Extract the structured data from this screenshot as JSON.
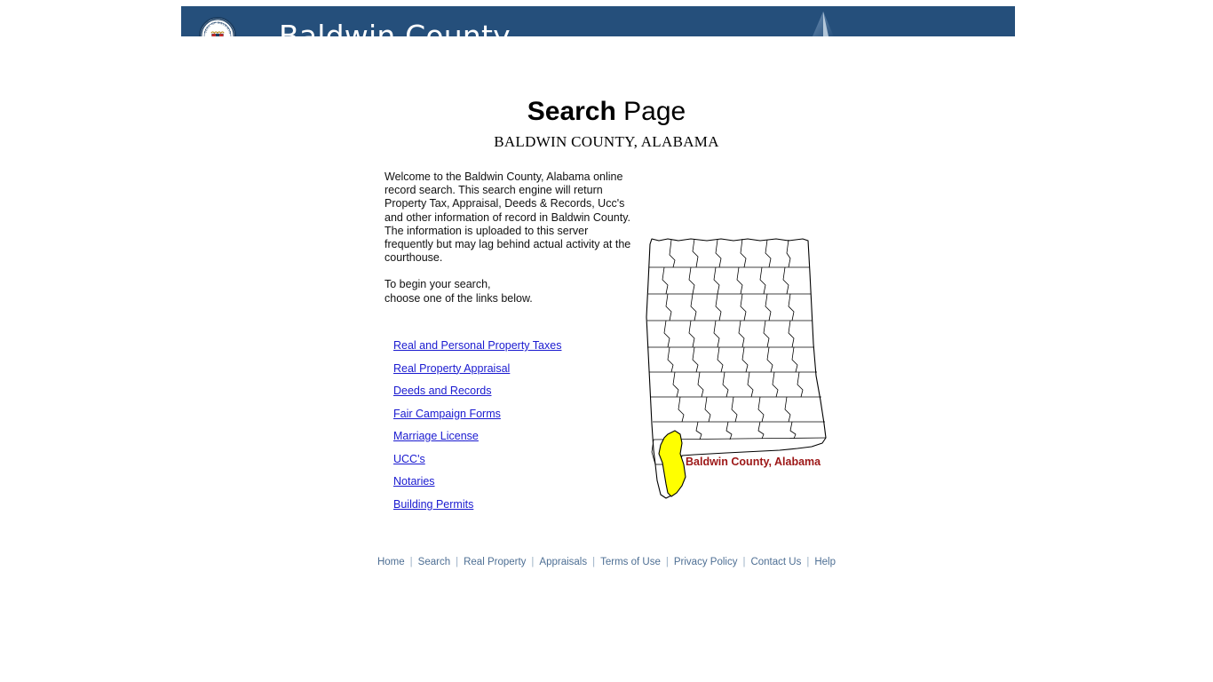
{
  "header": {
    "title": "Baldwin County",
    "seal_text": "SEAL OF BALDWIN COUNTY AL",
    "background_color": "#254f7b"
  },
  "title_block": {
    "title_bold": "Search",
    "title_rest": " Page",
    "subtitle": "BALDWIN COUNTY, ALABAMA"
  },
  "intro": {
    "paragraph": "Welcome to the Baldwin County, Alabama online record search. This search engine will return Property Tax, Appraisal, Deeds & Records, Ucc's and other information of record in Baldwin County. The information is uploaded to this server frequently but may lag behind actual activity at the courthouse.",
    "instruction_line1": "To begin your search,",
    "instruction_line2": "choose one of the links below."
  },
  "links": [
    {
      "label": "Real and Personal Property Taxes"
    },
    {
      "label": "Real Property Appraisal"
    },
    {
      "label": "Deeds and Records"
    },
    {
      "label": "Fair Campaign Forms"
    },
    {
      "label": "Marriage License"
    },
    {
      "label": "UCC's"
    },
    {
      "label": "Notaries"
    },
    {
      "label": "Building Permits"
    }
  ],
  "map": {
    "label": "Baldwin County, Alabama",
    "highlight_color": "#ffff00",
    "label_color": "#9c1616",
    "outline_color": "#000000",
    "state": "Alabama"
  },
  "footer": {
    "links": [
      {
        "label": "Home"
      },
      {
        "label": "Search"
      },
      {
        "label": "Real Property"
      },
      {
        "label": "Appraisals"
      },
      {
        "label": "Terms of Use"
      },
      {
        "label": "Privacy Policy"
      },
      {
        "label": "Contact Us"
      },
      {
        "label": "Help"
      }
    ],
    "separator": "|",
    "color": "#4e6f94"
  }
}
